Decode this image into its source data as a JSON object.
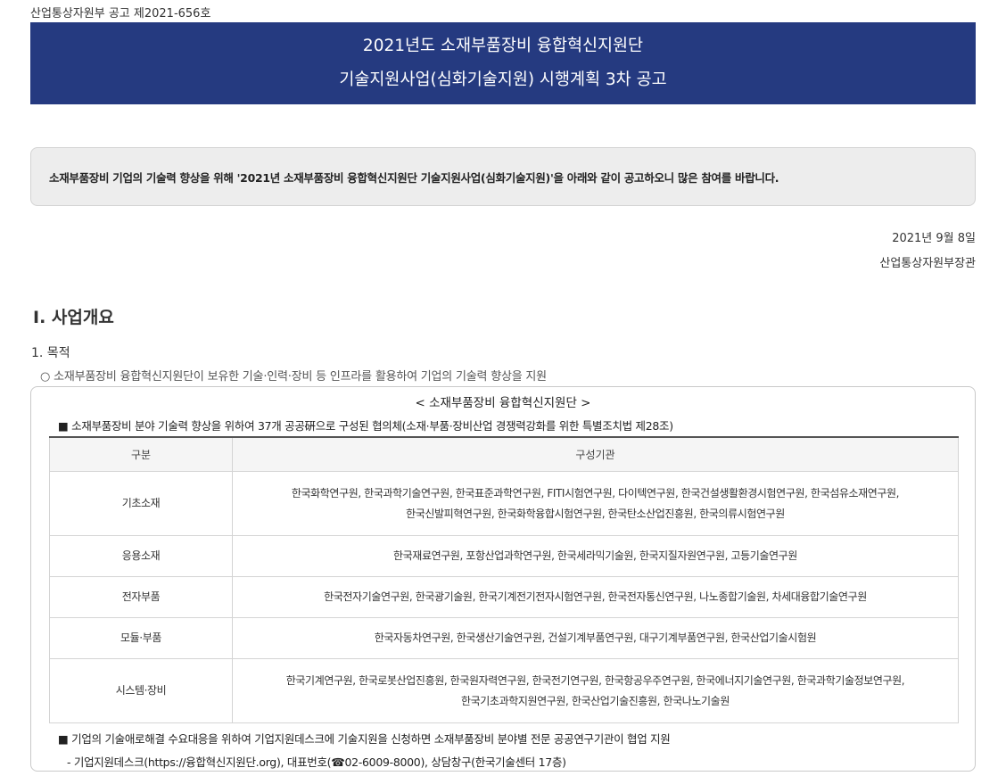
{
  "notice_number": "산업통상자원부 공고 제2021-656호",
  "banner": {
    "line1": "2021년도 소재부품장비 융합혁신지원단",
    "line2": "기술지원사업(심화기술지원) 시행계획 3차 공고"
  },
  "intro": "소재부품장비 기업의 기술력 향상을 위해 '2021년 소재부품장비 융합혁신지원단 기술지원사업(심화기술지원)'을 아래와 같이 공고하오니 많은 참여를 바랍니다.",
  "date": "2021년 9월 8일",
  "issuer": "산업통상자원부장관",
  "section": {
    "title": "Ⅰ. 사업개요",
    "subtitle": "1. 목적",
    "purpose": "○ 소재부품장비 융합혁신지원단이 보유한 기술·인력·장비 등 인프라를 활용하여 기업의 기술력 향상을 지원"
  },
  "panel": {
    "title": "< 소재부품장비 융합혁신지원단 >",
    "note": "■ 소재부품장비 분야 기술력 향상을 위하여 37개 공공硏으로 구성된 협의체(소재·부품·장비산업 경쟁력강화를 위한 특별조치법 제28조)",
    "table": {
      "headers": [
        "구분",
        "구성기관"
      ],
      "rows": [
        {
          "category": "기초소재",
          "line1": "한국화학연구원, 한국과학기술연구원, 한국표준과학연구원, FITI시험연구원, 다이텍연구원, 한국건설생활환경시험연구원, 한국섬유소재연구원,",
          "line2": "한국신발피혁연구원, 한국화학융합시험연구원, 한국탄소산업진흥원, 한국의류시험연구원"
        },
        {
          "category": "응용소재",
          "line1": "한국재료연구원, 포항산업과학연구원, 한국세라믹기술원, 한국지질자원연구원, 고등기술연구원",
          "line2": ""
        },
        {
          "category": "전자부품",
          "line1": "한국전자기술연구원, 한국광기술원, 한국기계전기전자시험연구원, 한국전자통신연구원, 나노종합기술원, 차세대융합기술연구원",
          "line2": ""
        },
        {
          "category": "모듈·부품",
          "line1": "한국자동차연구원, 한국생산기술연구원, 건설기계부품연구원, 대구기계부품연구원, 한국산업기술시험원",
          "line2": ""
        },
        {
          "category": "시스템·장비",
          "line1": "한국기계연구원, 한국로봇산업진흥원, 한국원자력연구원, 한국전기연구원, 한국항공우주연구원, 한국에너지기술연구원, 한국과학기술정보연구원,",
          "line2": "한국기초과학지원연구원, 한국산업기술진흥원, 한국나노기술원"
        }
      ]
    },
    "footer1": "■ 기업의 기술애로해결 수요대응을 위하여 기업지원데스크에 기술지원을 신청하면 소재부품장비 분야별 전문 공공연구기관이 협업 지원",
    "footer2": "- 기업지원데스크(https://융합혁신지원단.org), 대표번호(☎02-6009-8000), 상담창구(한국기술센터 17층)"
  }
}
